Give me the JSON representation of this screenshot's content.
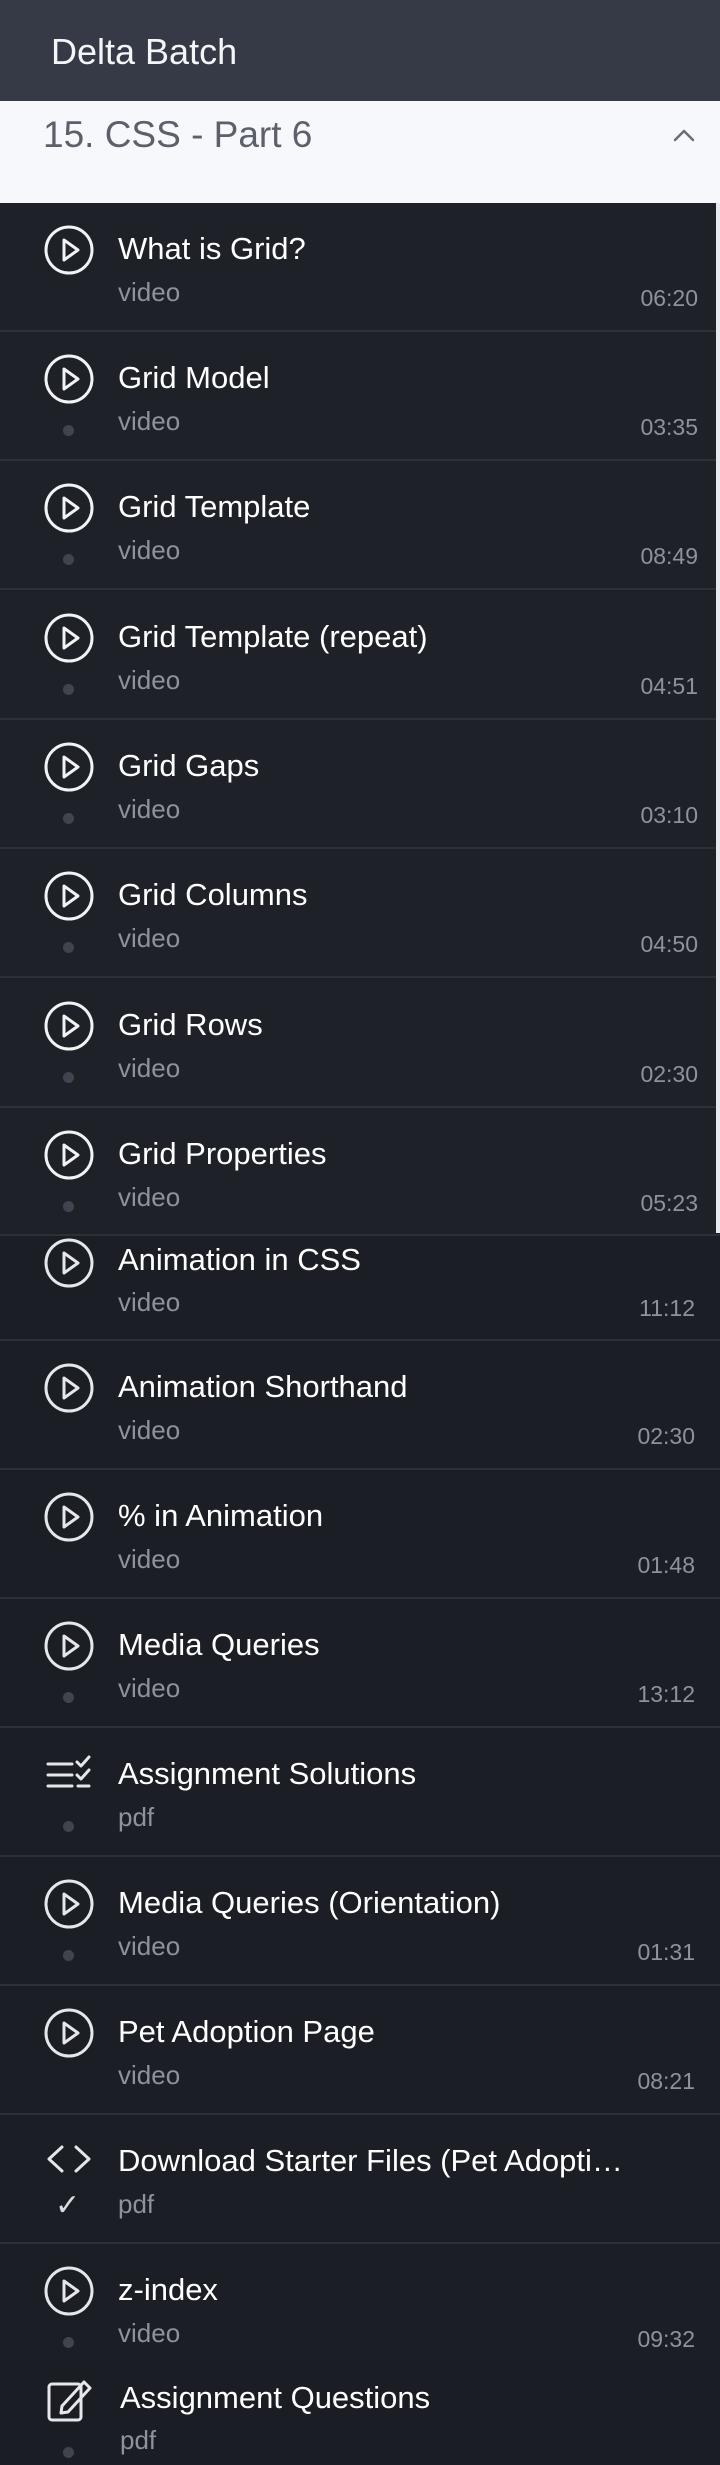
{
  "app": {
    "title": "Delta Batch"
  },
  "section": {
    "title": "15. CSS - Part 6"
  },
  "items": [
    {
      "name": "What is Grid?",
      "type": "video",
      "duration": "06:20",
      "icon": "play-icon"
    },
    {
      "name": "Grid Model",
      "type": "video",
      "duration": "03:35",
      "icon": "play-icon"
    },
    {
      "name": "Grid Template",
      "type": "video",
      "duration": "08:49",
      "icon": "play-icon"
    },
    {
      "name": "Grid Template (repeat)",
      "type": "video",
      "duration": "04:51",
      "icon": "play-icon"
    },
    {
      "name": "Grid Gaps",
      "type": "video",
      "duration": "03:10",
      "icon": "play-icon"
    },
    {
      "name": "Grid Columns",
      "type": "video",
      "duration": "04:50",
      "icon": "play-icon"
    },
    {
      "name": "Grid Rows",
      "type": "video",
      "duration": "02:30",
      "icon": "play-icon"
    },
    {
      "name": "Grid Properties",
      "type": "video",
      "duration": "05:23",
      "icon": "play-icon"
    },
    {
      "name": "Animation in CSS",
      "type": "video",
      "duration": "11:12",
      "icon": "play-icon"
    },
    {
      "name": "Animation Shorthand",
      "type": "video",
      "duration": "02:30",
      "icon": "play-icon"
    },
    {
      "name": "% in Animation",
      "type": "video",
      "duration": "01:48",
      "icon": "play-icon"
    },
    {
      "name": "Media Queries",
      "type": "video",
      "duration": "13:12",
      "icon": "play-icon"
    },
    {
      "name": "Assignment Solutions",
      "type": "pdf",
      "duration": "",
      "icon": "checklist-icon"
    },
    {
      "name": "Media Queries (Orientation)",
      "type": "video",
      "duration": "01:31",
      "icon": "play-icon"
    },
    {
      "name": "Pet Adoption Page",
      "type": "video",
      "duration": "08:21",
      "icon": "play-icon"
    },
    {
      "name": "Download Starter Files (Pet Adoption Page)",
      "type": "pdf",
      "duration": "",
      "icon": "code-icon"
    },
    {
      "name": "z-index",
      "type": "video",
      "duration": "09:32",
      "icon": "play-icon"
    },
    {
      "name": "Assignment Questions",
      "type": "pdf",
      "duration": "",
      "icon": "edit-icon"
    }
  ]
}
